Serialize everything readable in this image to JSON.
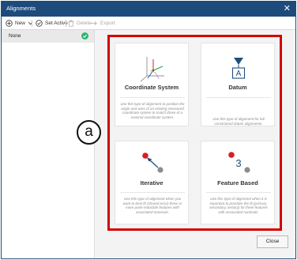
{
  "window": {
    "title": "Alignments",
    "close_glyph": "✕"
  },
  "toolbar": {
    "new_label": "New",
    "set_active_label": "Set Active",
    "delete_label": "Delete",
    "export_label": "Export"
  },
  "sidebar": {
    "items": [
      {
        "label": "None",
        "active": true
      }
    ]
  },
  "annotation": {
    "marker_label": "a",
    "highlight_color": "#d40000"
  },
  "cards": [
    {
      "title": "Coordinate System",
      "description": "Use this type of alignment to position the origin and axes of an existing measured coordinate system to match those of a nominal coordinate system.",
      "icon": "coordinate-axes-icon"
    },
    {
      "title": "Datum",
      "description": "Use this type of alignment for full constrained datum alignments.",
      "icon": "datum-icon",
      "icon_letter": "A"
    },
    {
      "title": "Iterative",
      "description": "Use this type of alignment when you want to best fit (shared error) three or more point-reducible features with associated nominals.",
      "icon": "iterative-icon"
    },
    {
      "title": "Feature Based",
      "description": "Use this type of alignment when it is important to prioritize the fit (primary, secondary, tertiary) for three features with associated nominals.",
      "icon": "feature-based-icon",
      "icon_number": "3"
    }
  ],
  "footer": {
    "close_label": "Close"
  },
  "colors": {
    "titlebar": "#1d4b7c",
    "accent_red": "#d40000",
    "check_green": "#2bb673",
    "point_gray": "#8c8c8c"
  }
}
